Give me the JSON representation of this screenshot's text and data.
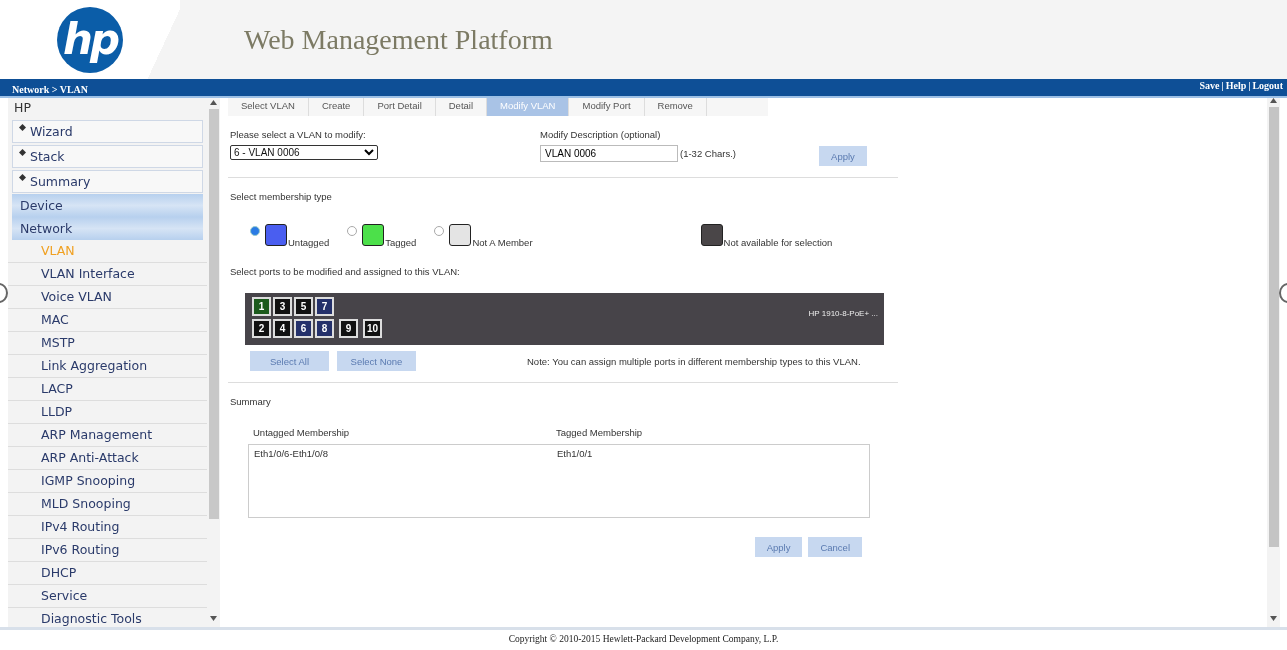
{
  "logo": {
    "text": "hp"
  },
  "title": "Web Management Platform",
  "breadcrumb": "Network > VLAN",
  "top_links": [
    "Save",
    "Help",
    "Logout"
  ],
  "top_links_separator": "|",
  "sidebar": {
    "title": "HP",
    "items": [
      {
        "label": "Wizard",
        "kind": "shortcut"
      },
      {
        "label": "Stack",
        "kind": "shortcut"
      },
      {
        "label": "Summary",
        "kind": "shortcut"
      },
      {
        "label": "Device",
        "kind": "section"
      },
      {
        "label": "Network",
        "kind": "section",
        "children": [
          {
            "label": "VLAN",
            "selected": true
          },
          {
            "label": "VLAN Interface",
            "selected": false
          },
          {
            "label": "Voice VLAN",
            "selected": false
          },
          {
            "label": "MAC",
            "selected": false
          },
          {
            "label": "MSTP",
            "selected": false
          },
          {
            "label": "Link Aggregation",
            "selected": false
          },
          {
            "label": "LACP",
            "selected": false
          },
          {
            "label": "LLDP",
            "selected": false
          },
          {
            "label": "ARP Management",
            "selected": false
          },
          {
            "label": "ARP Anti-Attack",
            "selected": false
          },
          {
            "label": "IGMP Snooping",
            "selected": false
          },
          {
            "label": "MLD Snooping",
            "selected": false
          },
          {
            "label": "IPv4 Routing",
            "selected": false
          },
          {
            "label": "IPv6 Routing",
            "selected": false
          },
          {
            "label": "DHCP",
            "selected": false
          },
          {
            "label": "Service",
            "selected": false
          },
          {
            "label": "Diagnostic Tools",
            "selected": false
          }
        ]
      }
    ]
  },
  "tabs": [
    {
      "label": "Select VLAN",
      "selected": false
    },
    {
      "label": "Create",
      "selected": false
    },
    {
      "label": "Port Detail",
      "selected": false
    },
    {
      "label": "Detail",
      "selected": false
    },
    {
      "label": "Modify VLAN",
      "selected": true
    },
    {
      "label": "Modify Port",
      "selected": false
    },
    {
      "label": "Remove",
      "selected": false
    }
  ],
  "vlan_select": {
    "label": "Please select a VLAN to modify:",
    "value": "6 - VLAN 0006"
  },
  "description": {
    "label": "Modify Description (optional)",
    "value": "VLAN 0006",
    "hint": "(1-32 Chars.)",
    "button": "Apply"
  },
  "membership": {
    "label": "Select membership type",
    "types": [
      {
        "label": "Untagged",
        "kind": "radio",
        "selected": true,
        "color": "#4a5ef0"
      },
      {
        "label": "Tagged",
        "kind": "radio",
        "selected": false,
        "color": "#4ce04a"
      },
      {
        "label": "Not A Member",
        "kind": "radio",
        "selected": false,
        "color": "#e4e4e4"
      },
      {
        "label": "Not available for selection",
        "kind": "legend",
        "color": "#4a4648"
      }
    ]
  },
  "ports_label": "Select ports to be modified and assigned to this VLAN:",
  "switch": {
    "model": "HP 1910-8-PoE+ ...",
    "ports": [
      {
        "label": "1",
        "color": "#1c5a1c"
      },
      {
        "label": "2",
        "color": "#111111"
      },
      {
        "label": "3",
        "color": "#111111"
      },
      {
        "label": "4",
        "color": "#111111"
      },
      {
        "label": "5",
        "color": "#111111"
      },
      {
        "label": "6",
        "color": "#24306a"
      },
      {
        "label": "7",
        "color": "#24306a"
      },
      {
        "label": "8",
        "color": "#24306a"
      },
      {
        "label": "9",
        "color": "#111111"
      },
      {
        "label": "10",
        "color": "#111111"
      }
    ]
  },
  "port_buttons": [
    "Select All",
    "Select None"
  ],
  "note": "Note: You can assign multiple ports in different membership types to this VLAN.",
  "summary": {
    "title": "Summary",
    "columns": [
      "Untagged Membership",
      "Tagged Membership"
    ],
    "values": [
      "Eth1/0/6-Eth1/0/8",
      "Eth1/0/1"
    ]
  },
  "actions": [
    "Apply",
    "Cancel"
  ],
  "footer": "Copyright © 2010-2015 Hewlett-Packard Development Company, L.P."
}
